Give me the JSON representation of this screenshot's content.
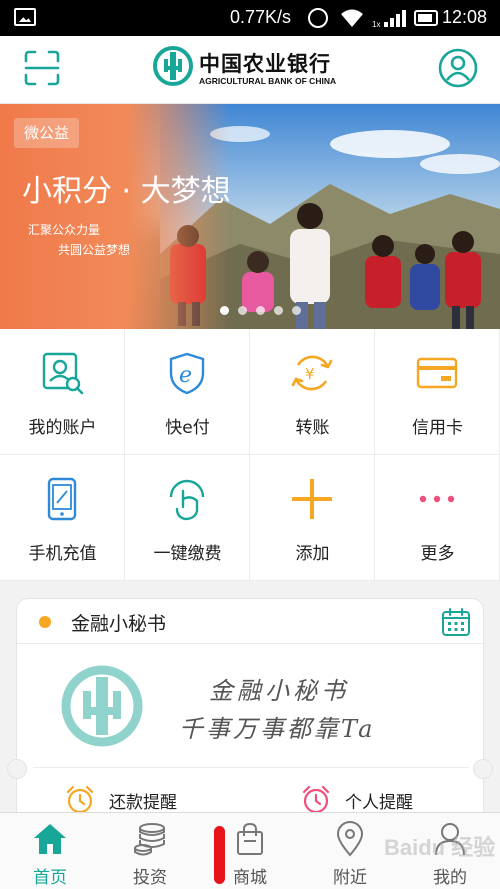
{
  "status_bar": {
    "speed": "0.77K/s",
    "time": "12:08",
    "signal_label": "1x"
  },
  "header": {
    "logo_cn": "中国农业银行",
    "logo_en": "AGRICULTURAL BANK OF CHINA",
    "left_icon": "scan-icon",
    "right_icon": "user-profile-icon"
  },
  "banner": {
    "tag": "微公益",
    "title": "小积分 · 大梦想",
    "sub1": "汇聚公众力量",
    "sub2": "共圆公益梦想",
    "slides": 5,
    "active_slide": 1
  },
  "services": [
    {
      "label": "我的账户",
      "icon": "account-search-icon"
    },
    {
      "label": "快e付",
      "icon": "e-pay-shield-icon"
    },
    {
      "label": "转账",
      "icon": "transfer-yuan-icon"
    },
    {
      "label": "信用卡",
      "icon": "credit-card-icon"
    },
    {
      "label": "手机充值",
      "icon": "phone-recharge-icon"
    },
    {
      "label": "一键缴费",
      "icon": "tap-pay-icon"
    },
    {
      "label": "添加",
      "icon": "plus-icon"
    },
    {
      "label": "更多",
      "icon": "more-dots-icon"
    }
  ],
  "secretary": {
    "title": "金融小秘书",
    "line1": "金融小秘书",
    "line2": "千事万事都靠Ta",
    "reminders": [
      {
        "label": "还款提醒",
        "icon": "alarm-clock-icon"
      },
      {
        "label": "个人提醒",
        "icon": "alarm-clock-icon"
      }
    ]
  },
  "bottom_nav": [
    {
      "label": "首页",
      "icon": "home-icon",
      "active": true
    },
    {
      "label": "投资",
      "icon": "coins-icon",
      "active": false
    },
    {
      "label": "商城",
      "icon": "shopping-bag-icon",
      "active": false
    },
    {
      "label": "附近",
      "icon": "location-pin-icon",
      "active": false
    },
    {
      "label": "我的",
      "icon": "person-icon",
      "active": false
    }
  ],
  "watermark": "Baidu 经验",
  "colors": {
    "brand_teal": "#17a698",
    "accent_orange": "#f5a623",
    "banner_orange": "#f0794a",
    "more_pink": "#ef4f7a",
    "status_bar": "#000000"
  }
}
